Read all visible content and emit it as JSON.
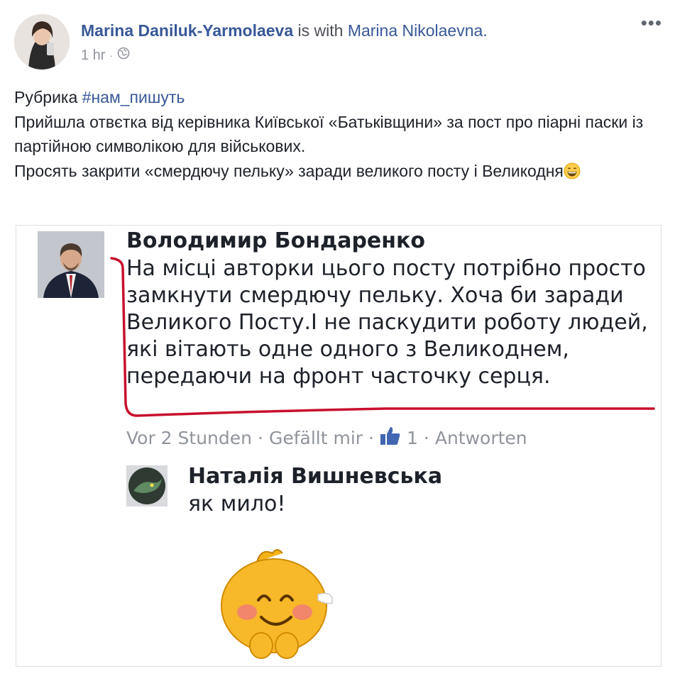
{
  "post": {
    "author": "Marina Daniluk-Yarmolaeva",
    "with_text": "is with",
    "tagged": "Marina Nikolaevna.",
    "time": "1 hr",
    "separator": "·",
    "privacy_icon": "globe-icon",
    "more_icon": "ellipsis-icon",
    "more_label": "•••"
  },
  "text": {
    "line1_prefix": "Рубрика ",
    "hashtag": "#нам_пишуть",
    "line2": "Прийшла отвєтка від керівника Київської «Батьківщини» за пост про піарні паски із партійною символікою для військових.",
    "line3": "Просять закрити «смердючу пельку» заради великого посту і Великодня",
    "emoji": "grinning-face-emoji"
  },
  "embedded": {
    "comment1": {
      "author": "Володимир Бондаренко",
      "body": "На місці  авторки цього посту потрібно просто замкнути смердючу пельку. Хоча би заради Великого Посту.І не паскудити роботу людей, які вітають одне одного з Великоднем, передаючи на фронт часточку серця.",
      "time": "Vor 2 Stunden",
      "dot": "·",
      "like_label": "Gefällt mir",
      "like_icon": "thumbs-up-icon",
      "like_count": "1",
      "reply_label": "Antworten"
    },
    "comment2": {
      "author": "Наталія Вишневська",
      "body": "як мило!"
    },
    "sticker": "smiling-bun-sticker",
    "mark_color": "#c8102e"
  }
}
